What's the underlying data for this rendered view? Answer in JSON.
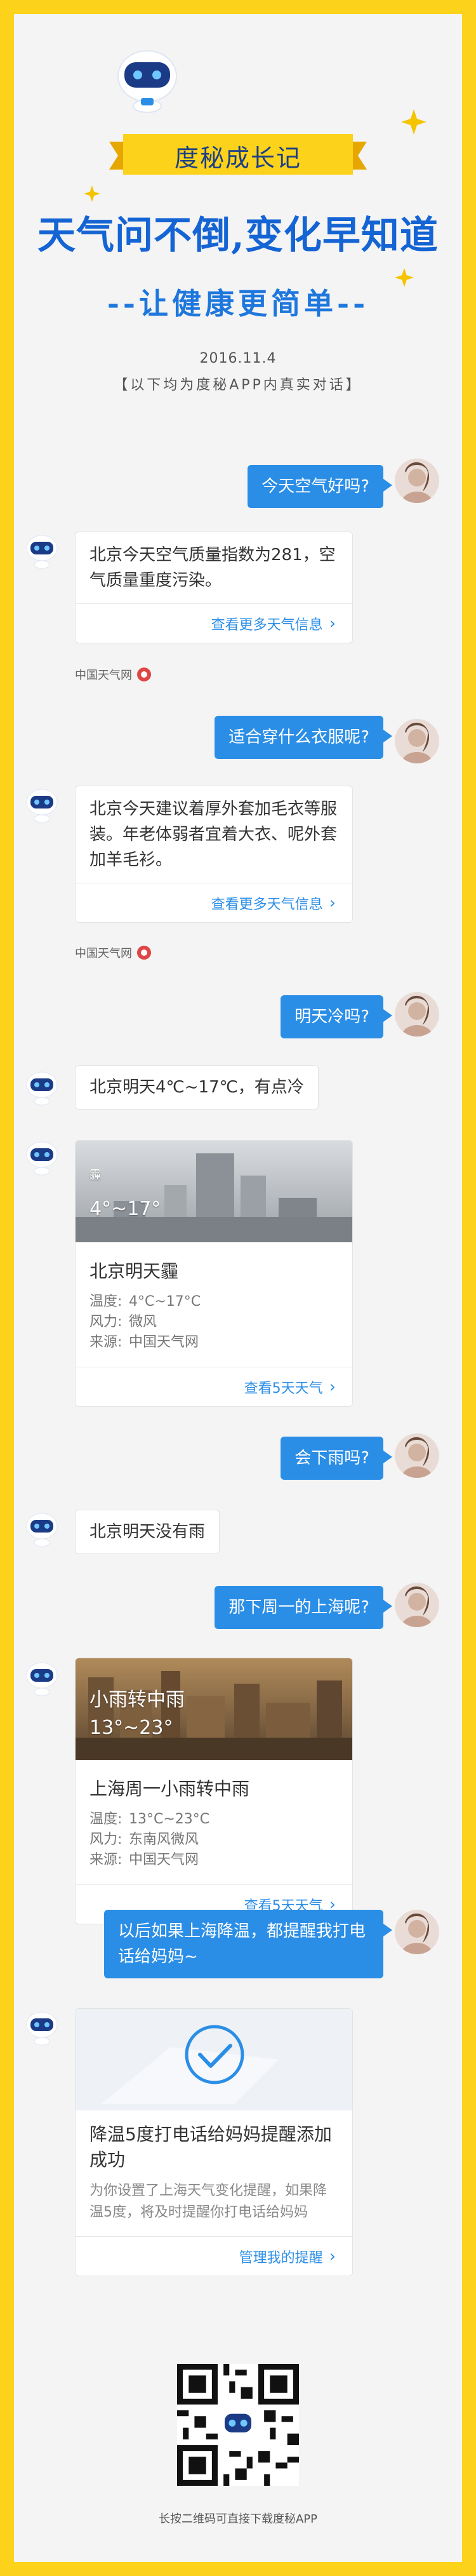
{
  "header": {
    "banner": "度秘成长记",
    "headline": "天气问不倒,变化早知道",
    "subhead": "--让健康更简单--",
    "date": "2016.11.4",
    "notice": "【以下均为度秘APP内真实对话】"
  },
  "chat": {
    "q1": "今天空气好吗?",
    "a1": "北京今天空气质量指数为281，空气质量重度污染。",
    "a1_link": "查看更多天气信息",
    "a1_source": "中国天气网",
    "q2": "适合穿什么衣服呢?",
    "a2": "北京今天建议着厚外套加毛衣等服装。年老体弱者宜着大衣、呢外套加羊毛衫。",
    "a2_link": "查看更多天气信息",
    "a2_source": "中国天气网",
    "q3": "明天冷吗?",
    "a3": "北京明天4℃~17℃，有点冷",
    "card3": {
      "photo_icon": "霾",
      "photo_temp": "4°~17°",
      "title": "北京明天霾",
      "temp_label": "温度:",
      "temp_value": "4°C~17°C",
      "wind_label": "风力:",
      "wind_value": "微风",
      "src_label": "来源:",
      "src_value": "中国天气网",
      "link": "查看5天天气"
    },
    "q4": "会下雨吗?",
    "a4": "北京明天没有雨",
    "q5": "那下周一的上海呢?",
    "card5": {
      "photo_title": "小雨转中雨",
      "photo_temp": "13°~23°",
      "title": "上海周一小雨转中雨",
      "temp_label": "温度:",
      "temp_value": "13°C~23°C",
      "wind_label": "风力:",
      "wind_value": "东南风微风",
      "src_label": "来源:",
      "src_value": "中国天气网",
      "link": "查看5天天气"
    },
    "q6": "以后如果上海降温，都提醒我打电话给妈妈~",
    "card6": {
      "title": "降温5度打电话给妈妈提醒添加成功",
      "desc": "为你设置了上海天气变化提醒，如果降温5度，将及时提醒你打电话给妈妈",
      "link": "管理我的提醒"
    }
  },
  "footer": {
    "caption": "长按二维码可直接下载度秘APP"
  },
  "colors": {
    "frame": "#fcd21b",
    "accent": "#2b8ee6",
    "headline": "#1464d4",
    "banner_text": "#1c3f86"
  }
}
